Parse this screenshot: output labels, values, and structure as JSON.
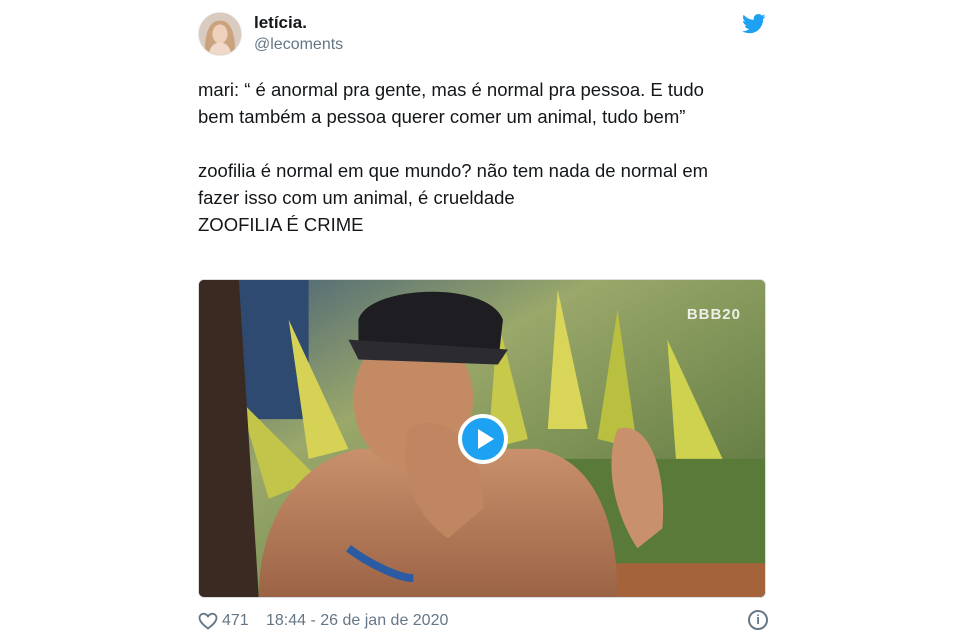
{
  "author": {
    "display_name": "letícia.",
    "handle": "@lecoments"
  },
  "tweet": {
    "lines": [
      "mari: “ é anormal pra gente, mas é normal pra pessoa. E tudo",
      "bem também a pessoa querer comer um animal, tudo bem”",
      "zoofilia é normal em que mundo? não tem nada de normal em",
      "fazer isso com um animal, é crueldade",
      "ZOOFILIA É CRIME"
    ]
  },
  "media": {
    "watermark": "BBB20",
    "play_icon": "play-icon"
  },
  "footer": {
    "likes": "471",
    "timestamp": "18:44 - 26 de jan de 2020",
    "info_glyph": "i"
  },
  "colors": {
    "twitter_blue": "#1da1f2",
    "text": "#14171a",
    "muted": "#657786"
  },
  "icons": [
    "avatar",
    "twitter-bird-icon",
    "play-icon",
    "heart-icon",
    "info-icon"
  ]
}
